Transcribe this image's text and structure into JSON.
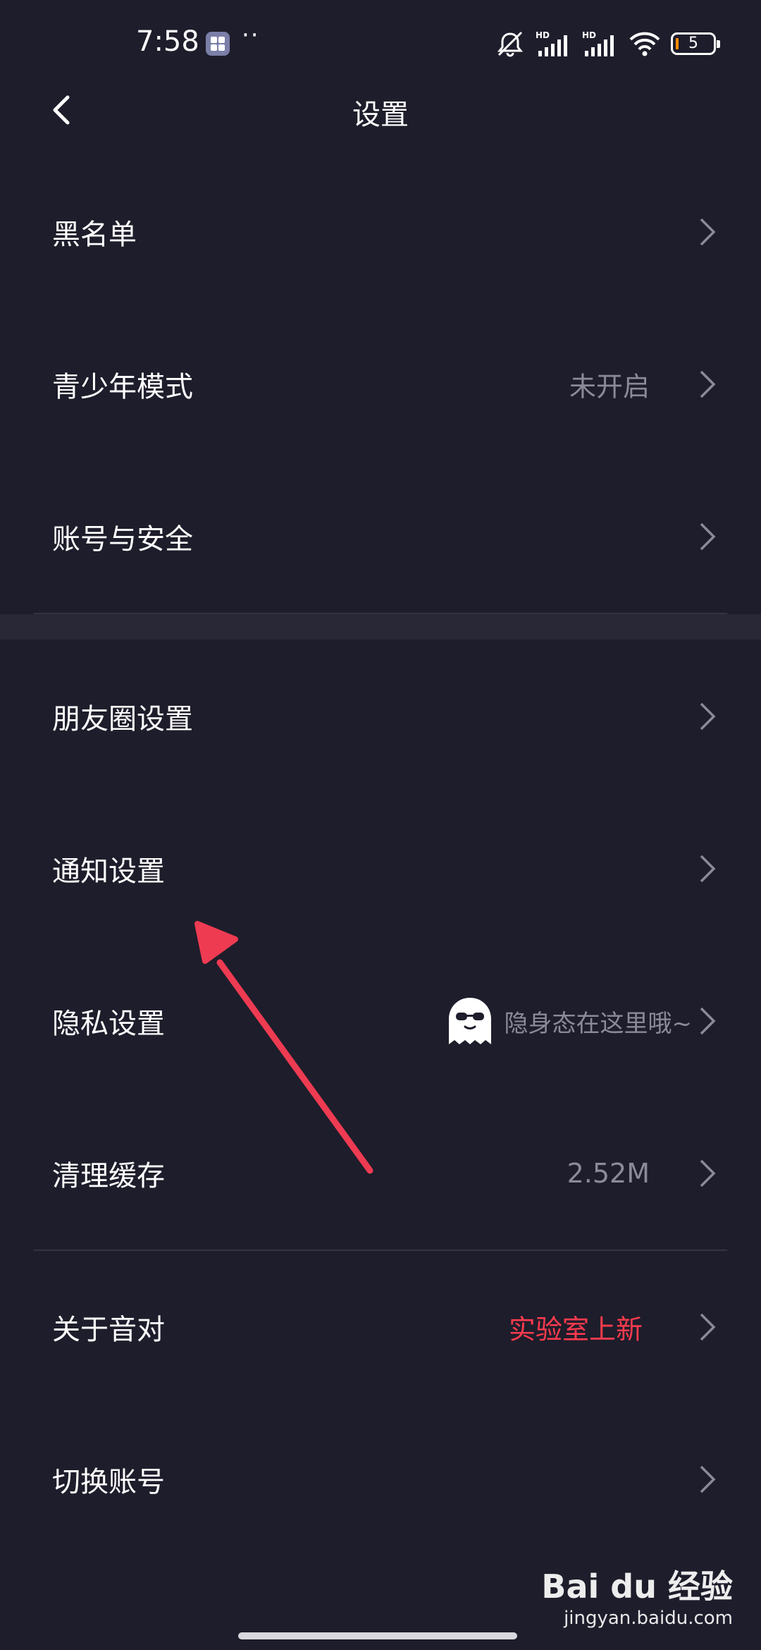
{
  "status_bar": {
    "time": "7:58",
    "dots": "··",
    "battery": "5",
    "icons": [
      "app-icon",
      "mute-icon",
      "signal-hd-icon",
      "signal-hd-icon",
      "wifi-icon",
      "battery-icon"
    ]
  },
  "header": {
    "title": "设置",
    "back_icon": "back-icon"
  },
  "group1": [
    {
      "label": "黑名单",
      "value": ""
    },
    {
      "label": "青少年模式",
      "value": "未开启"
    },
    {
      "label": "账号与安全",
      "value": ""
    }
  ],
  "group2": [
    {
      "label": "朋友圈设置",
      "value": ""
    },
    {
      "label": "通知设置",
      "value": ""
    },
    {
      "label": "隐私设置",
      "value": "隐身态在这里哦~",
      "icon": "ghost-icon"
    },
    {
      "label": "清理缓存",
      "value": "2.52M"
    }
  ],
  "group3": [
    {
      "label": "关于音对",
      "value": "实验室上新"
    },
    {
      "label": "切换账号",
      "value": ""
    }
  ],
  "colors": {
    "background": "#1e1d2b",
    "accent_red": "#ff3b4e",
    "annotation_arrow": "#ee3b52"
  },
  "watermark": {
    "logo": "Bai du 经验",
    "url": "jingyan.baidu.com"
  }
}
